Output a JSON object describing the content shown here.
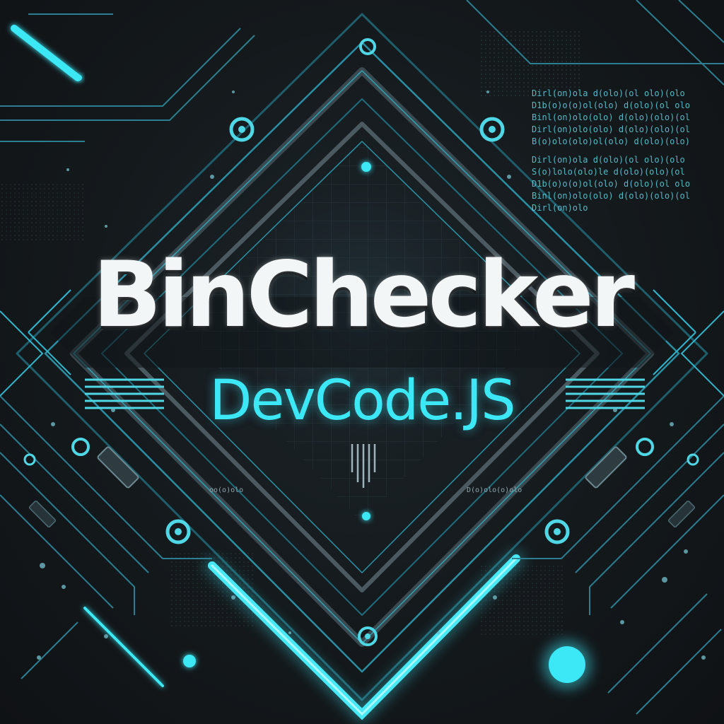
{
  "title": "BinChecker",
  "subtitle": "DevCode.JS",
  "decorative_code": {
    "block_1": [
      "Dirl(on)ola d(olo)(ol olo)(olo",
      "D1b(o)o(o)ol(olo) d(olo)(ol olo",
      "Binl(on)olo(olo) d(olo)(olo)(ol",
      "Dirl(on)olo(olo) d(olo)(olo)(ol",
      "B(o)olo(olo)ol(olo) d(olo)(olo)"
    ],
    "block_2": [
      "Dirl(on)ola d(olo)(ol olo)(olo",
      "S(o)lolo(olo)le d(olo)(olo)(ol",
      "D1b(o)o(o)ol(olo) d(olo)(ol olo",
      "Binl(on)olo(olo) d(olo)(olo)(ol",
      "Dirl(on)olo"
    ],
    "tiny_left": "oo(o)olo",
    "tiny_right": "D(o)olo(o)olo"
  },
  "colors": {
    "background": "#14191c",
    "accent": "#3ce8f5",
    "title": "#f3f6f7",
    "line": "#2b7f90"
  }
}
